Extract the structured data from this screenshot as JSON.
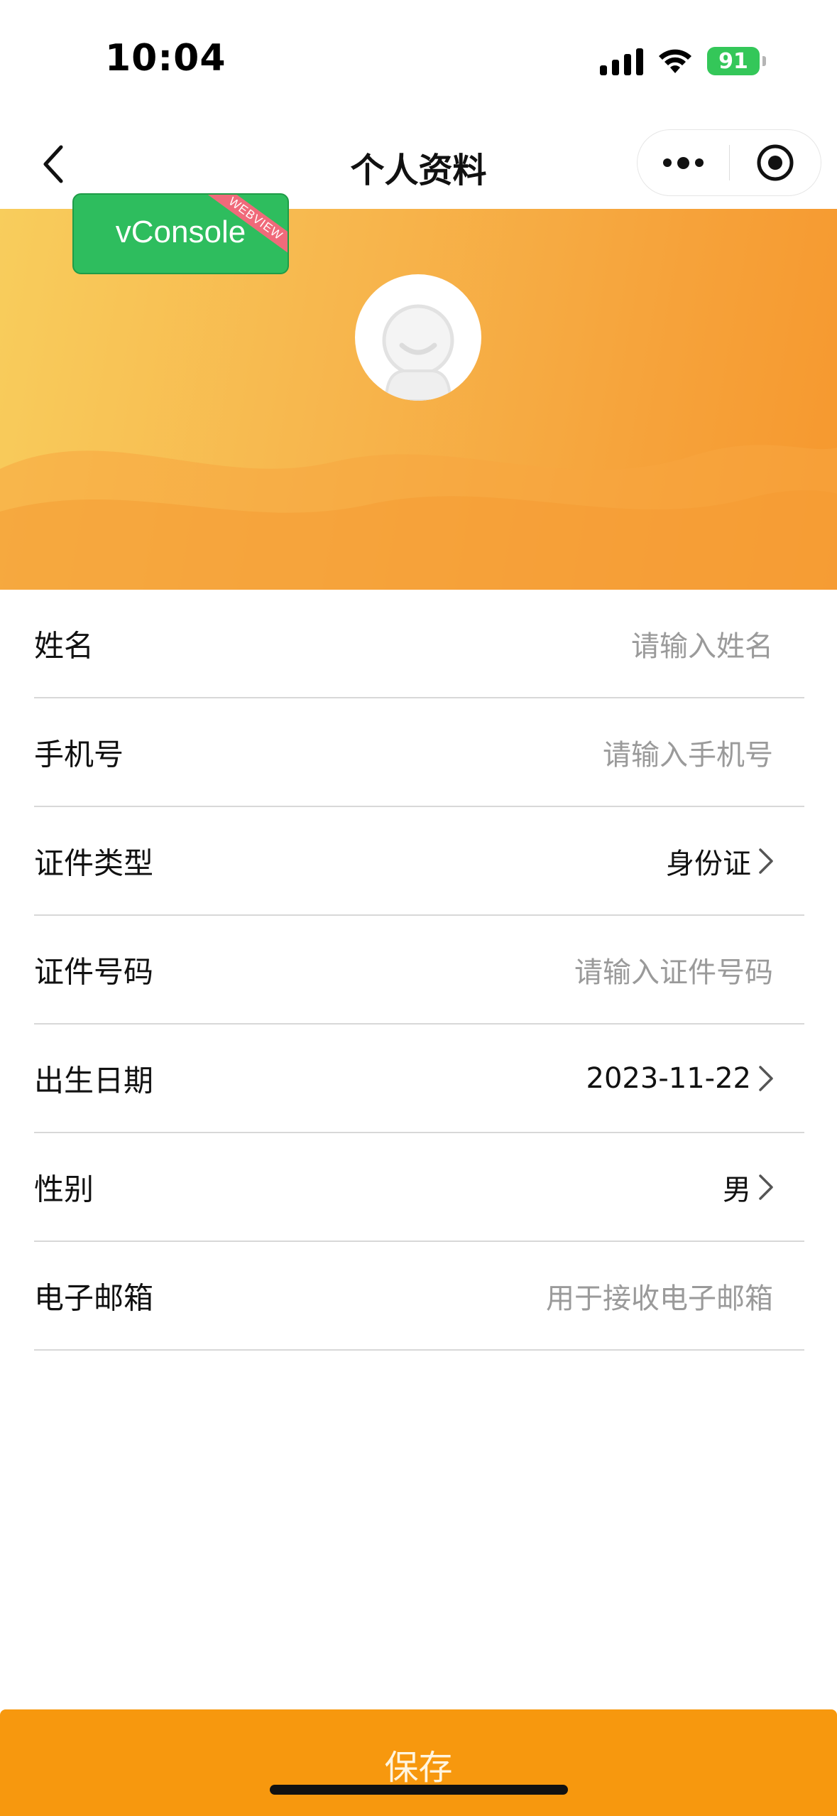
{
  "status_bar": {
    "time": "10:04",
    "battery": "91",
    "battery_color": "#34c759",
    "icons": [
      "signal-icon",
      "wifi-icon",
      "battery-charging-icon"
    ]
  },
  "nav": {
    "title": "个人资料",
    "back_icon": "chevron-left-icon",
    "more_icon": "more-dots-icon",
    "close_icon": "target-circle-icon"
  },
  "banner": {
    "gradient": [
      "#f8cd5c",
      "#f6982e"
    ],
    "avatar_icon": "default-avatar-icon"
  },
  "vconsole": {
    "label": "vConsole",
    "ribbon": "WEBVIEW"
  },
  "form": {
    "rows": [
      {
        "label": "姓名",
        "value": "请输入姓名",
        "kind": "input"
      },
      {
        "label": "手机号",
        "value": "请输入手机号",
        "kind": "input"
      },
      {
        "label": "证件类型",
        "value": "身份证",
        "kind": "select"
      },
      {
        "label": "证件号码",
        "value": "请输入证件号码",
        "kind": "input"
      },
      {
        "label": "出生日期",
        "value": "2023-11-22",
        "kind": "select"
      },
      {
        "label": "性别",
        "value": "男",
        "kind": "select"
      },
      {
        "label": "电子邮箱",
        "value": "用于接收电子邮箱",
        "kind": "input"
      }
    ]
  },
  "save": {
    "label": "保存",
    "color": "#f7980e"
  }
}
